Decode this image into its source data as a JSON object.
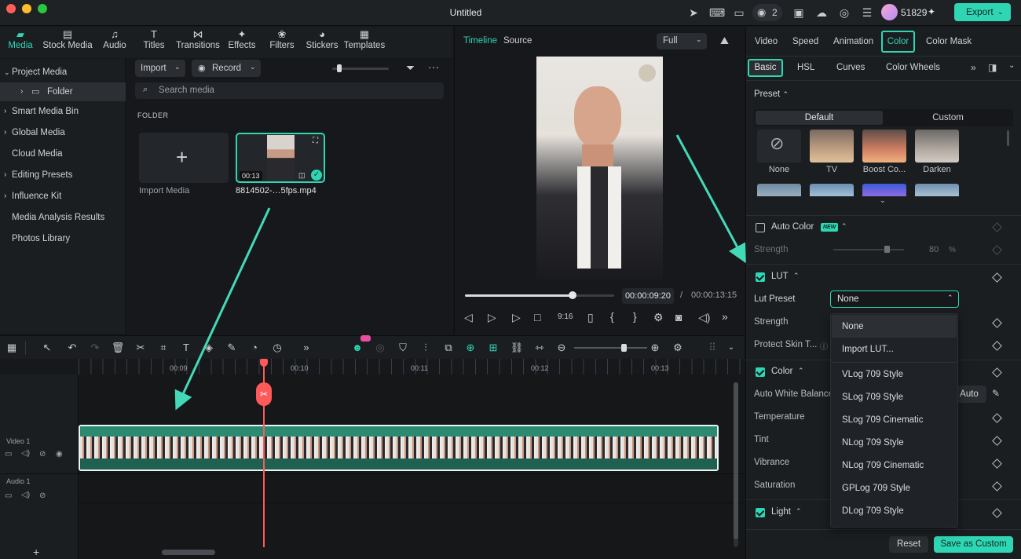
{
  "title": "Untitled",
  "titlebar": {
    "credits": "51829",
    "export_label": "Export",
    "notif_count": "2"
  },
  "media_tabs": [
    {
      "label": "Media",
      "icon": "media-icon"
    },
    {
      "label": "Stock Media",
      "icon": "stock-media-icon"
    },
    {
      "label": "Audio",
      "icon": "audio-icon"
    },
    {
      "label": "Titles",
      "icon": "titles-icon"
    },
    {
      "label": "Transitions",
      "icon": "transitions-icon"
    },
    {
      "label": "Effects",
      "icon": "effects-icon"
    },
    {
      "label": "Filters",
      "icon": "filters-icon"
    },
    {
      "label": "Stickers",
      "icon": "stickers-icon"
    },
    {
      "label": "Templates",
      "icon": "templates-icon"
    }
  ],
  "sidebar": {
    "items": [
      "Project Media",
      "Folder",
      "Smart Media Bin",
      "Global Media",
      "Cloud Media",
      "Editing Presets",
      "Influence Kit",
      "Media Analysis Results",
      "Photos Library"
    ]
  },
  "media": {
    "import_label": "Import",
    "record_label": "Record",
    "search_placeholder": "Search media",
    "folder_heading": "FOLDER",
    "import_media_label": "Import Media",
    "clip_name": "8814502-…5fps.mp4",
    "clip_duration": "00:13"
  },
  "preview": {
    "tab_timeline": "Timeline",
    "tab_source": "Source",
    "quality": "Full",
    "current_time": "00:00:09:20",
    "separator": "/",
    "total_time": "00:00:13:15",
    "progress": 0.72
  },
  "right": {
    "tabs": [
      "Video",
      "Speed",
      "Animation",
      "Color",
      "Color Mask"
    ],
    "subtabs": [
      "Basic",
      "HSL",
      "Curves",
      "Color Wheels"
    ],
    "preset_label": "Preset",
    "preset_default": "Default",
    "preset_custom": "Custom",
    "presets": [
      "None",
      "TV",
      "Boost Co...",
      "Darken"
    ],
    "auto_color": "Auto Color",
    "new_badge": "NEW",
    "strength": "Strength",
    "strength_value": "80",
    "strength_unit": "%",
    "lut": "LUT",
    "lut_preset": "Lut Preset",
    "lut_selected": "None",
    "lut_strength": "Strength",
    "protect_skin": "Protect Skin T...",
    "color_section": "Color",
    "awb": "Auto White Balance",
    "awb_btn": "Auto",
    "temperature": "Temperature",
    "tint": "Tint",
    "vibrance": "Vibrance",
    "saturation": "Saturation",
    "light": "Light",
    "reset": "Reset",
    "save_custom": "Save as Custom"
  },
  "lut_options": [
    "None",
    "Import LUT...",
    "VLog 709 Style",
    "SLog 709 Style",
    "SLog 709 Cinematic",
    "NLog 709 Style",
    "NLog 709 Cinematic",
    "GPLog 709 Style",
    "DLog 709 Style"
  ],
  "timeline": {
    "ticks": [
      "00:09",
      "00:10",
      "00:11",
      "00:12",
      "00:13"
    ],
    "video_track": "Video 1",
    "audio_track": "Audio 1"
  },
  "colors": {
    "accent": "#2fd6b4",
    "playhead": "#ff5a5a"
  }
}
